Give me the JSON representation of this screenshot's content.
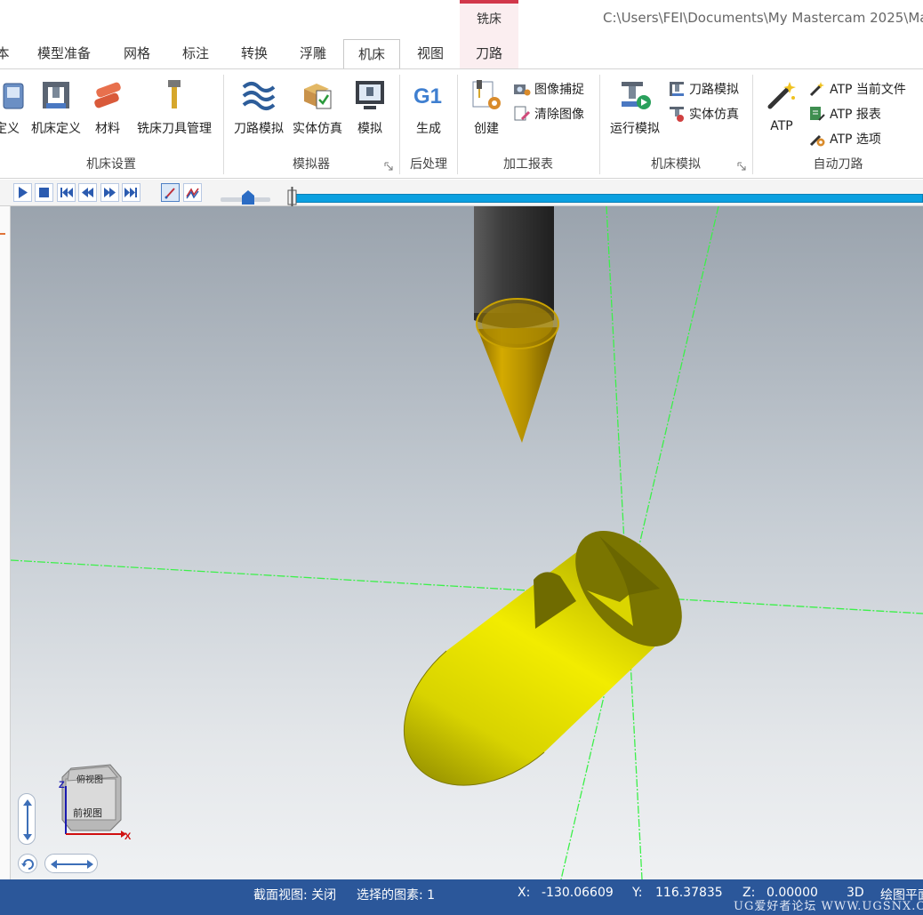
{
  "titlebar": {
    "context_tab_group": "铣床",
    "path": "C:\\Users\\FEI\\Documents\\My Mastercam 2025\\Ma"
  },
  "tabs": [
    {
      "label": "本",
      "active": false
    },
    {
      "label": "模型准备",
      "active": false
    },
    {
      "label": "网格",
      "active": false
    },
    {
      "label": "标注",
      "active": false
    },
    {
      "label": "转换",
      "active": false
    },
    {
      "label": "浮雕",
      "active": false
    },
    {
      "label": "机床",
      "active": true
    },
    {
      "label": "视图",
      "active": false
    },
    {
      "label": "刀路",
      "active": false,
      "contextual": true
    }
  ],
  "ribbon": {
    "machine_setup": {
      "title": "机床设置",
      "buttons": [
        "定义",
        "机床定义",
        "材料",
        "铣床刀具管理"
      ]
    },
    "simulator": {
      "title": "模拟器",
      "buttons": [
        "刀路模拟",
        "实体仿真",
        "模拟"
      ]
    },
    "post": {
      "title": "后处理",
      "buttons": [
        "生成"
      ]
    },
    "report": {
      "title": "加工报表",
      "big": "创建",
      "small": [
        "图像捕捉",
        "清除图像"
      ]
    },
    "machine_sim": {
      "title": "机床模拟",
      "big": "运行模拟",
      "small": [
        "刀路模拟",
        "实体仿真"
      ]
    },
    "auto_toolpath": {
      "title": "自动刀路",
      "big": "ATP",
      "small": [
        "ATP 当前文件",
        "ATP 报表",
        "ATP 选项"
      ]
    }
  },
  "simbar": {
    "playback_progress": 0.0,
    "speed_level": 0.55
  },
  "viewcube": {
    "top_face": "俯视图",
    "front_face": "前视图",
    "axis_z": "Z",
    "axis_x": "X"
  },
  "statusbar": {
    "section_view": "截面视图: 关闭",
    "selected": "选择的图素: 1",
    "x_label": "X:",
    "x_value": "-130.06609",
    "y_label": "Y:",
    "y_value": "116.37835",
    "z_label": "Z:",
    "z_value": "0.00000",
    "mode": "3D",
    "plane": "绘图平面"
  },
  "watermark": "UG爱好者论坛 WWW.UGSNX.COM",
  "colors": {
    "accent": "#2b579a",
    "context_tab": "#d1374a",
    "part_yellow": "#e5e000",
    "tool_gold": "#d4aa00",
    "axis_green": "#3cf04a",
    "timeline": "#0aa0e0"
  }
}
